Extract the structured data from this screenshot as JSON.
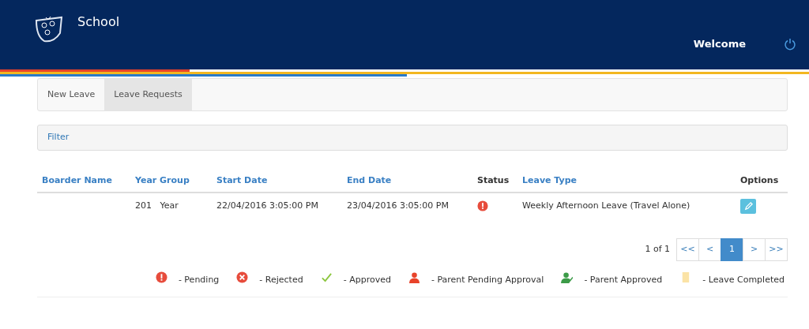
{
  "header": {
    "title": "School",
    "welcome": "Welcome"
  },
  "tabs": [
    {
      "label": "New Leave",
      "selected": false
    },
    {
      "label": "Leave Requests",
      "selected": true
    }
  ],
  "filter": {
    "label": "Filter"
  },
  "table": {
    "columns": [
      {
        "label": "Boarder Name",
        "sortable": true
      },
      {
        "label": "Year Group",
        "sortable": true
      },
      {
        "label": "Start Date",
        "sortable": true
      },
      {
        "label": "End Date",
        "sortable": true
      },
      {
        "label": "Status",
        "sortable": false
      },
      {
        "label": "Leave Type",
        "sortable": true
      },
      {
        "label": "Options",
        "sortable": false
      }
    ],
    "rows": [
      {
        "year_group": "201   Year",
        "start_date": "22/04/2016 3:05:00 PM",
        "end_date": "23/04/2016 3:05:00 PM",
        "kind": "pending",
        "leave_type": "Weekly Afternoon Leave (Travel Alone)"
      }
    ]
  },
  "pagination": {
    "summary": "1 of 1",
    "buttons": [
      {
        "label": "<<",
        "selected": false
      },
      {
        "label": "<",
        "selected": false
      },
      {
        "label": "1",
        "selected": true
      },
      {
        "label": ">",
        "selected": false
      },
      {
        "label": ">>",
        "selected": false
      }
    ]
  },
  "legend": [
    {
      "kind": "pending",
      "label": "- Pending"
    },
    {
      "kind": "rejected",
      "label": "- Rejected"
    },
    {
      "kind": "approved",
      "label": "- Approved"
    },
    {
      "kind": "parent_pending",
      "label": "- Parent Pending Approval"
    },
    {
      "kind": "parent_approved",
      "label": "- Parent Approved"
    },
    {
      "kind": "completed",
      "label": "- Leave Completed"
    }
  ]
}
